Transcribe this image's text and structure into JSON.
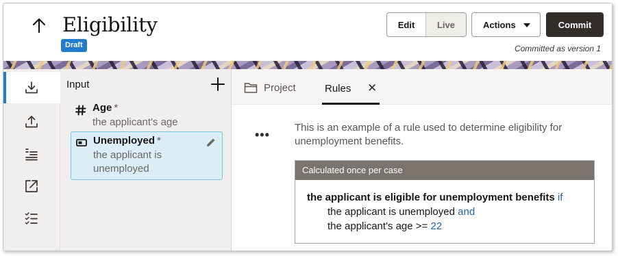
{
  "header": {
    "title": "Eligibility",
    "status_badge": "Draft",
    "edit_label": "Edit",
    "live_label": "Live",
    "actions_label": "Actions",
    "commit_label": "Commit",
    "committed_text": "Committed as version 1"
  },
  "sidebar": {
    "items": [
      {
        "name": "input",
        "icon": "download-icon",
        "active": true
      },
      {
        "name": "output",
        "icon": "upload-icon",
        "active": false
      },
      {
        "name": "list",
        "icon": "list-icon",
        "active": false
      },
      {
        "name": "external",
        "icon": "external-link-icon",
        "active": false
      },
      {
        "name": "checklist",
        "icon": "checklist-icon",
        "active": false
      }
    ]
  },
  "input_panel": {
    "heading": "Input",
    "attributes": [
      {
        "name": "Age",
        "required_mark": "*",
        "description": "the applicant's age",
        "type_icon": "hash-icon",
        "selected": false
      },
      {
        "name": "Unemployed",
        "required_mark": "*",
        "description_line1": "the applicant is",
        "description_line2": "unemployed",
        "type_icon": "toggle-icon",
        "selected": true
      }
    ]
  },
  "tabs": {
    "project_label": "Project",
    "rules_label": "Rules",
    "close_glyph": "✕"
  },
  "rule": {
    "more_glyph": "•••",
    "description": "This is an example of a rule used to determine eligibility for unemployment benefits.",
    "box_header": "Calculated once per case",
    "conclusion": "the applicant is eligible for unemployment benefits",
    "if_keyword": "if",
    "condition1": "the applicant is unemployed",
    "and_keyword": "and",
    "condition2_prefix": "the applicant's age >= ",
    "condition2_value": "22"
  },
  "colors": {
    "accent": "#227bcd",
    "commit_bg": "#312d2a",
    "keyword": "#1f63a8",
    "selected_bg": "#dbeef7"
  }
}
